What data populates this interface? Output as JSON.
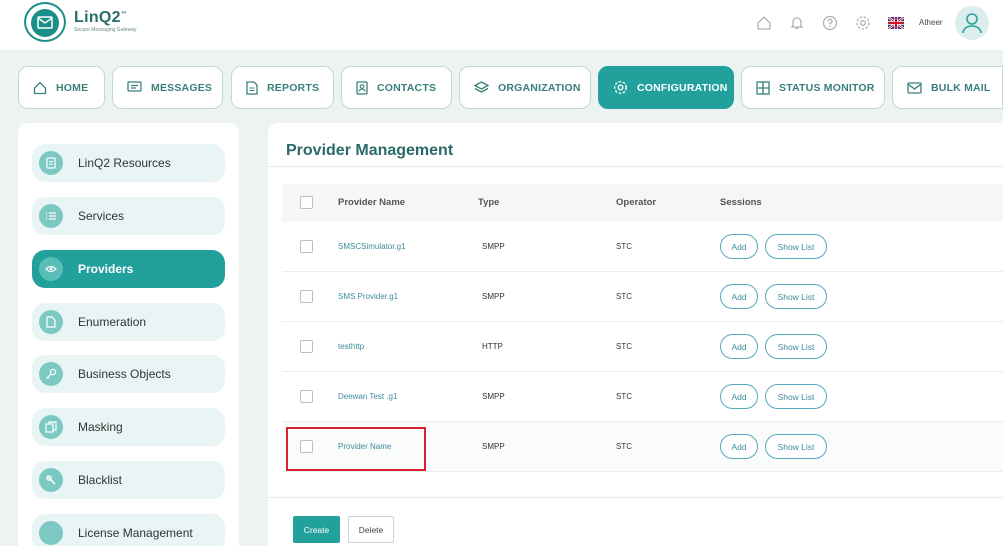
{
  "header": {
    "logo_title": "LinQ2",
    "logo_tm": "™",
    "logo_subtitle": "Secure Messaging Gateway",
    "user_name": "Atheer"
  },
  "nav": {
    "items": [
      {
        "label": "HOME",
        "icon": "home-icon"
      },
      {
        "label": "MESSAGES",
        "icon": "messages-icon"
      },
      {
        "label": "REPORTS",
        "icon": "reports-icon"
      },
      {
        "label": "CONTACTS",
        "icon": "contacts-icon"
      },
      {
        "label": "ORGANIZATION",
        "icon": "layers-icon"
      },
      {
        "label": "CONFIGURATION",
        "icon": "gear-icon",
        "active": true
      },
      {
        "label": "STATUS MONITOR",
        "icon": "grid-icon"
      },
      {
        "label": "BULK MAIL",
        "icon": "mail-icon"
      }
    ]
  },
  "sidebar": {
    "items": [
      {
        "label": "LinQ2 Resources",
        "icon": "resources-icon"
      },
      {
        "label": "Services",
        "icon": "services-icon"
      },
      {
        "label": "Providers",
        "icon": "providers-icon",
        "active": true
      },
      {
        "label": "Enumeration",
        "icon": "document-icon"
      },
      {
        "label": "Business Objects",
        "icon": "key-icon"
      },
      {
        "label": "Masking",
        "icon": "copy-icon"
      },
      {
        "label": "Blacklist",
        "icon": "block-icon"
      },
      {
        "label": "License Management",
        "icon": "license-icon"
      }
    ]
  },
  "main": {
    "title": "Provider Management",
    "columns": [
      "Provider Name",
      "Type",
      "Operator",
      "Sessions"
    ],
    "rows": [
      {
        "name": "SMSCSimulator.g1",
        "type": "SMPP",
        "operator": "STC"
      },
      {
        "name": "SMS Provider.g1",
        "type": "SMPP",
        "operator": "STC"
      },
      {
        "name": "testhttp",
        "type": "HTTP",
        "operator": "STC"
      },
      {
        "name": "Deewan Test .g1",
        "type": "SMPP",
        "operator": "STC"
      },
      {
        "name": "Provider Name",
        "type": "SMPP",
        "operator": "STC"
      }
    ],
    "add_label": "Add",
    "show_list_label": "Show List",
    "create_label": "Create",
    "delete_label": "Delete"
  },
  "colors": {
    "accent": "#22a19c",
    "highlight_border": "#d8242c"
  }
}
